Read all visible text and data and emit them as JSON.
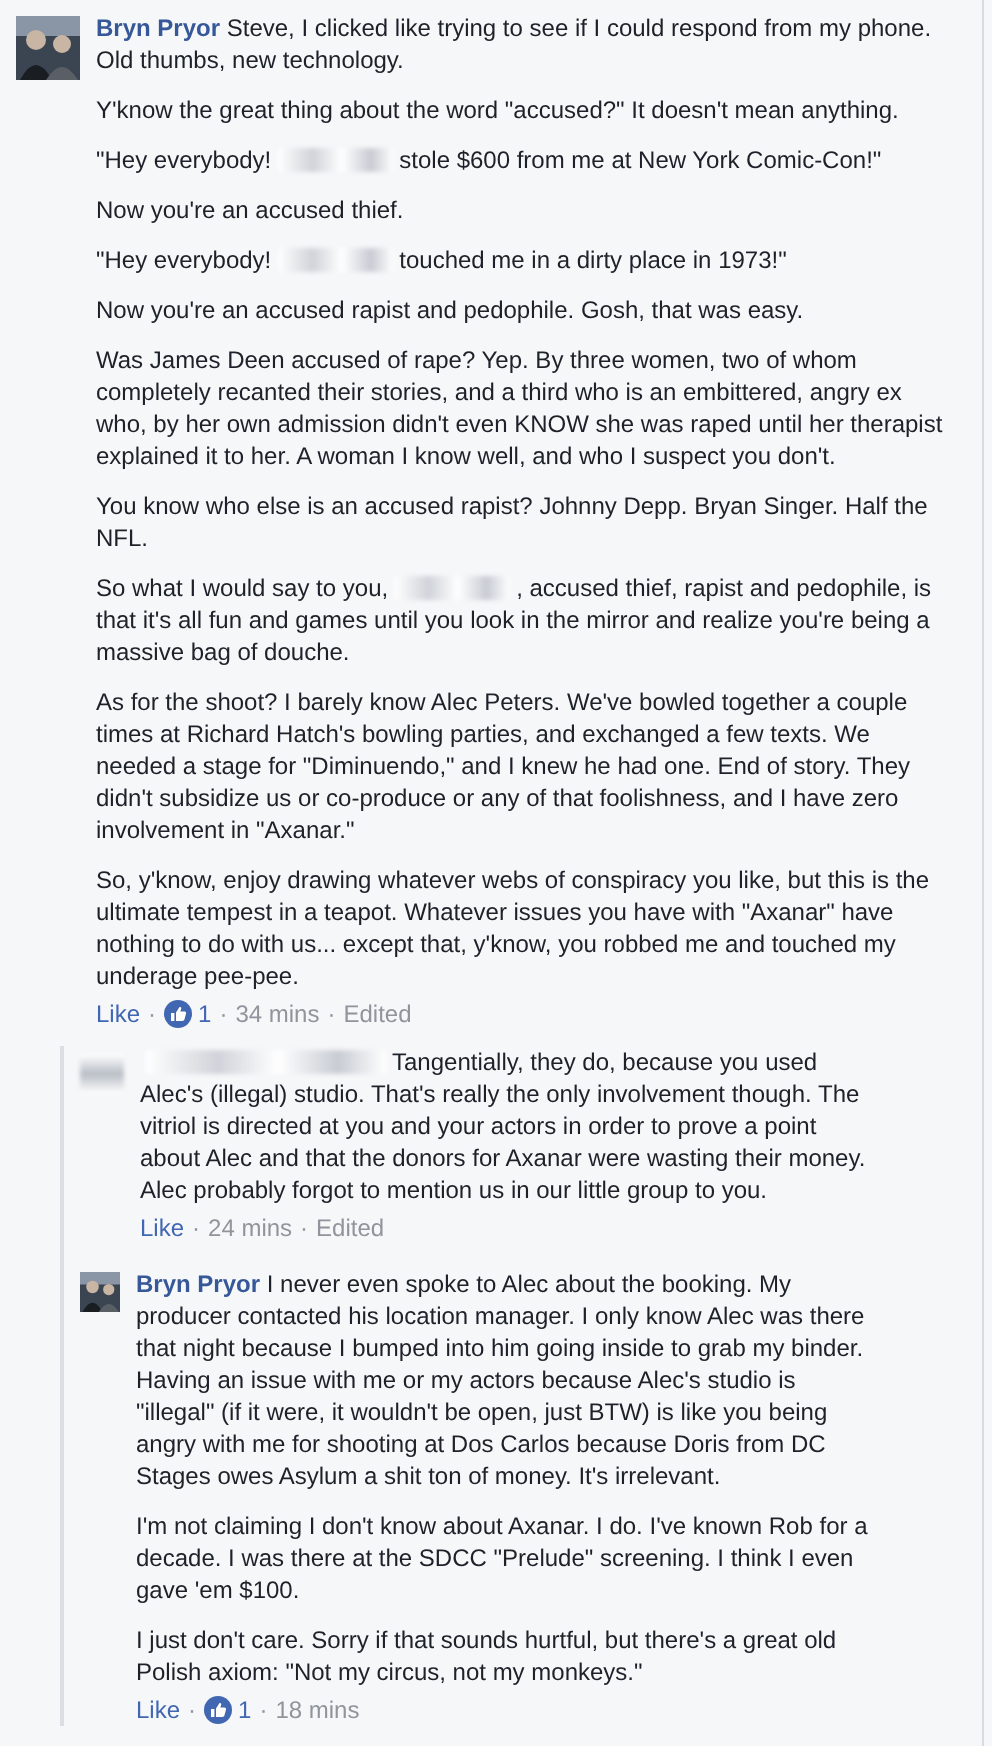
{
  "comments": [
    {
      "author": "Bryn Pryor",
      "paragraphs": [
        {
          "parts": [
            "Steve, I clicked like trying to see if I could respond from my phone. Old thumbs, new technology."
          ]
        },
        {
          "parts": [
            "Y'know the great thing about the word \"accused?\" It doesn't mean anything."
          ]
        },
        {
          "parts": [
            "\"Hey everybody!",
            "stole $600 from me at New York Comic-Con!\""
          ]
        },
        {
          "parts": [
            "Now you're an accused thief."
          ]
        },
        {
          "parts": [
            "\"Hey everybody!",
            "touched me in a dirty place in 1973!\""
          ]
        },
        {
          "parts": [
            "Now you're an accused rapist and pedophile. Gosh, that was easy."
          ]
        },
        {
          "parts": [
            "Was James Deen accused of rape? Yep. By three women, two of whom completely recanted their stories, and a third who is an embittered, angry ex who, by her own admission didn't even KNOW she was raped until her therapist explained it to her. A woman I know well, and who I suspect you don't."
          ]
        },
        {
          "parts": [
            "You know who else is an accused rapist? Johnny Depp. Bryan Singer. Half the NFL."
          ]
        },
        {
          "parts": [
            "So what I would say to you,",
            ", accused thief, rapist and pedophile, is that it's all fun and games until you look in the mirror and realize you're being a massive bag of douche."
          ]
        },
        {
          "parts": [
            "As for the shoot? I barely know Alec Peters. We've bowled together a couple times at Richard Hatch's bowling parties, and exchanged a few texts. We needed a stage for \"Diminuendo,\" and I knew he had one. End of story. They didn't subsidize us or co-produce or any of that foolishness, and I have zero involvement in \"Axanar.\""
          ]
        },
        {
          "parts": [
            "So, y'know, enjoy drawing whatever webs of conspiracy you like, but this is the ultimate tempest in a teapot. Whatever issues you have with \"Axanar\" have nothing to do with us... except that, y'know, you robbed me and touched my underage pee-pee."
          ]
        }
      ],
      "meta": [
        {
          "kind": "link",
          "text": "Like"
        },
        {
          "kind": "sep",
          "text": "·"
        },
        {
          "kind": "reactions",
          "text": "1"
        },
        {
          "kind": "sep",
          "text": "·"
        },
        {
          "kind": "time",
          "text": "34 mins"
        },
        {
          "kind": "sep",
          "text": "·"
        },
        {
          "kind": "time",
          "text": "Edited"
        }
      ],
      "replies": [
        {
          "paragraphs": [
            {
              "parts": [
                "Tangentially, they do, because you used Alec's (illegal) studio. That's really the only involvement though. The vitriol is directed at you and your actors in order to prove a point about Alec and that the donors for Axanar were wasting their money. Alec probably forgot to mention us in our little group to you."
              ]
            }
          ],
          "meta": [
            {
              "kind": "link",
              "text": "Like"
            },
            {
              "kind": "sep",
              "text": "·"
            },
            {
              "kind": "time",
              "text": "24 mins"
            },
            {
              "kind": "sep",
              "text": "·"
            },
            {
              "kind": "time",
              "text": "Edited"
            }
          ]
        },
        {
          "author": "Bryn Pryor",
          "paragraphs": [
            {
              "parts": [
                "I never even spoke to Alec about the booking. My producer contacted his location manager. I only know Alec was there that night because I bumped into him going inside to grab my binder. Having an issue with me or my actors because Alec's studio is \"illegal\" (if it were, it wouldn't be open, just BTW) is like you being angry with me for shooting at Dos Carlos because Doris from DC Stages owes Asylum a shit ton of money. It's irrelevant."
              ]
            },
            {
              "parts": [
                "I'm not claiming I don't know about Axanar. I do. I've known Rob for a decade. I was there at the SDCC \"Prelude\" screening. I think I even gave 'em $100."
              ]
            },
            {
              "parts": [
                "I just don't care. Sorry if that sounds hurtful, but there's a great old Polish axiom: \"Not my circus, not my monkeys.\""
              ]
            }
          ],
          "meta": [
            {
              "kind": "link",
              "text": "Like"
            },
            {
              "kind": "sep",
              "text": "·"
            },
            {
              "kind": "reactions",
              "text": "1"
            },
            {
              "kind": "sep",
              "text": "·"
            },
            {
              "kind": "time",
              "text": "18 mins"
            }
          ]
        }
      ]
    }
  ]
}
